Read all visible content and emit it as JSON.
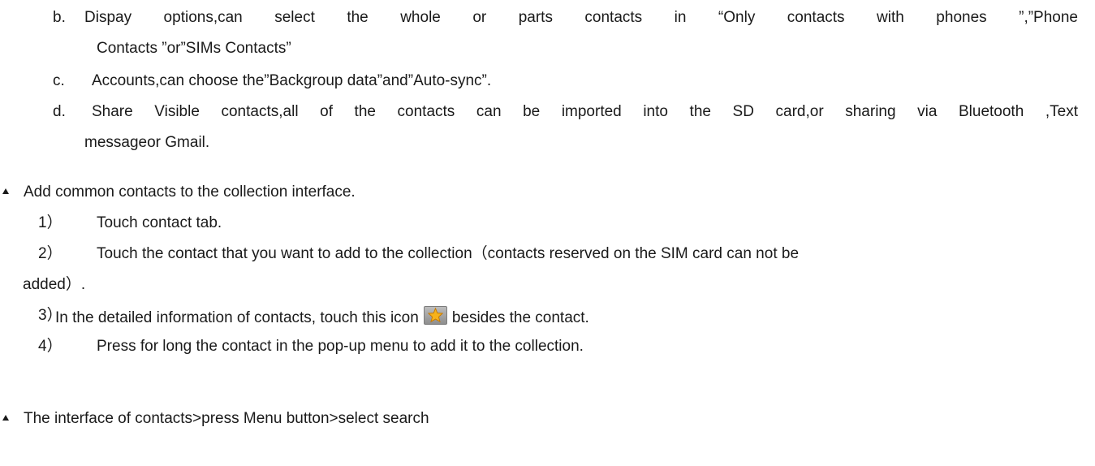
{
  "sub_items": {
    "b": {
      "marker": "b.",
      "text_line1": "Dispay options,can select the whole or parts contacts in “Only contacts with phones ”,”Phone",
      "text_line2": "Contacts ”or”SIMs Contacts”"
    },
    "c": {
      "marker": "c.",
      "text": "Accounts,can choose the”Backgroup data”and”Auto-sync”."
    },
    "d": {
      "marker": "d.",
      "text_line1": "Share Visible contacts,all of the contacts can be imported into the SD card,or sharing via Bluetooth ,Text",
      "text_line2": "messageor Gmail."
    }
  },
  "section_collection": {
    "heading": "Add common contacts to the collection interface.",
    "steps": [
      {
        "num": "1）",
        "text": "Touch contact tab."
      },
      {
        "num": "2）",
        "text": "Touch the contact that you want to add to the collection（contacts reserved on the SIM card can not be",
        "cont": "added）."
      },
      {
        "num": "3）",
        "text_before": "In the detailed information of contacts, touch this icon",
        "icon": "star-icon",
        "text_after": "besides the contact."
      },
      {
        "num": "4）",
        "text": "Press for long the contact in the pop-up menu to add it to the collection."
      }
    ]
  },
  "section_search": {
    "heading": "The interface of contacts>press Menu button>select search"
  }
}
